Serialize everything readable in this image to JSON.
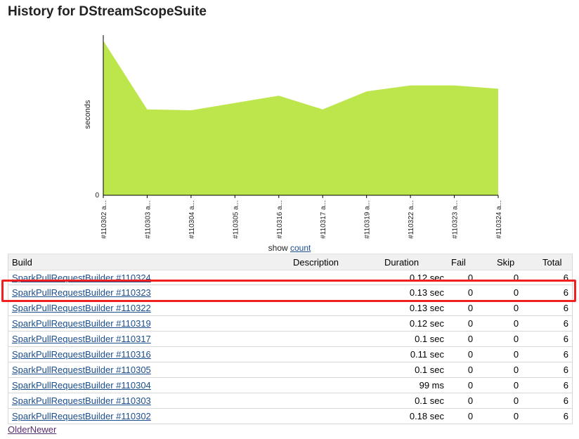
{
  "page": {
    "title": "History for DStreamScopeSuite"
  },
  "chart_data": {
    "type": "area",
    "ylabel": "seconds",
    "y_tick_labels": [
      "0"
    ],
    "ylim": [
      0,
      0.18
    ],
    "categories": [
      "#110302 a...",
      "#110303 a...",
      "#110304 a...",
      "#110305 a...",
      "#110316 a...",
      "#110317 a...",
      "#110319 a...",
      "#110322 a...",
      "#110323 a...",
      "#110324 a..."
    ],
    "values": [
      0.18,
      0.1,
      0.099,
      0.1075,
      0.116,
      0.1,
      0.121,
      0.128,
      0.128,
      0.124
    ],
    "fill_color": "#bce64b"
  },
  "show": {
    "prefix": "show",
    "link": "count"
  },
  "table": {
    "headers": {
      "build": "Build",
      "description": "Description",
      "duration": "Duration",
      "fail": "Fail",
      "skip": "Skip",
      "total": "Total"
    },
    "rows": [
      {
        "build": "SparkPullRequestBuilder #110324",
        "description": "",
        "duration": "0.12 sec",
        "fail": "0",
        "skip": "0",
        "total": "6"
      },
      {
        "build": "SparkPullRequestBuilder #110323",
        "description": "",
        "duration": "0.13 sec",
        "fail": "0",
        "skip": "0",
        "total": "6"
      },
      {
        "build": "SparkPullRequestBuilder #110322",
        "description": "",
        "duration": "0.13 sec",
        "fail": "0",
        "skip": "0",
        "total": "6"
      },
      {
        "build": "SparkPullRequestBuilder #110319",
        "description": "",
        "duration": "0.12 sec",
        "fail": "0",
        "skip": "0",
        "total": "6"
      },
      {
        "build": "SparkPullRequestBuilder #110317",
        "description": "",
        "duration": "0.1 sec",
        "fail": "0",
        "skip": "0",
        "total": "6"
      },
      {
        "build": "SparkPullRequestBuilder #110316",
        "description": "",
        "duration": "0.11 sec",
        "fail": "0",
        "skip": "0",
        "total": "6"
      },
      {
        "build": "SparkPullRequestBuilder #110305",
        "description": "",
        "duration": "0.1 sec",
        "fail": "0",
        "skip": "0",
        "total": "6"
      },
      {
        "build": "SparkPullRequestBuilder #110304",
        "description": "",
        "duration": "99 ms",
        "fail": "0",
        "skip": "0",
        "total": "6"
      },
      {
        "build": "SparkPullRequestBuilder #110303",
        "description": "",
        "duration": "0.1 sec",
        "fail": "0",
        "skip": "0",
        "total": "6"
      },
      {
        "build": "SparkPullRequestBuilder #110302",
        "description": "",
        "duration": "0.18 sec",
        "fail": "0",
        "skip": "0",
        "total": "6"
      }
    ]
  },
  "pager": {
    "older": "Older",
    "newer": "Newer"
  },
  "highlight": {
    "row_index": 1,
    "color": "#f02020"
  }
}
